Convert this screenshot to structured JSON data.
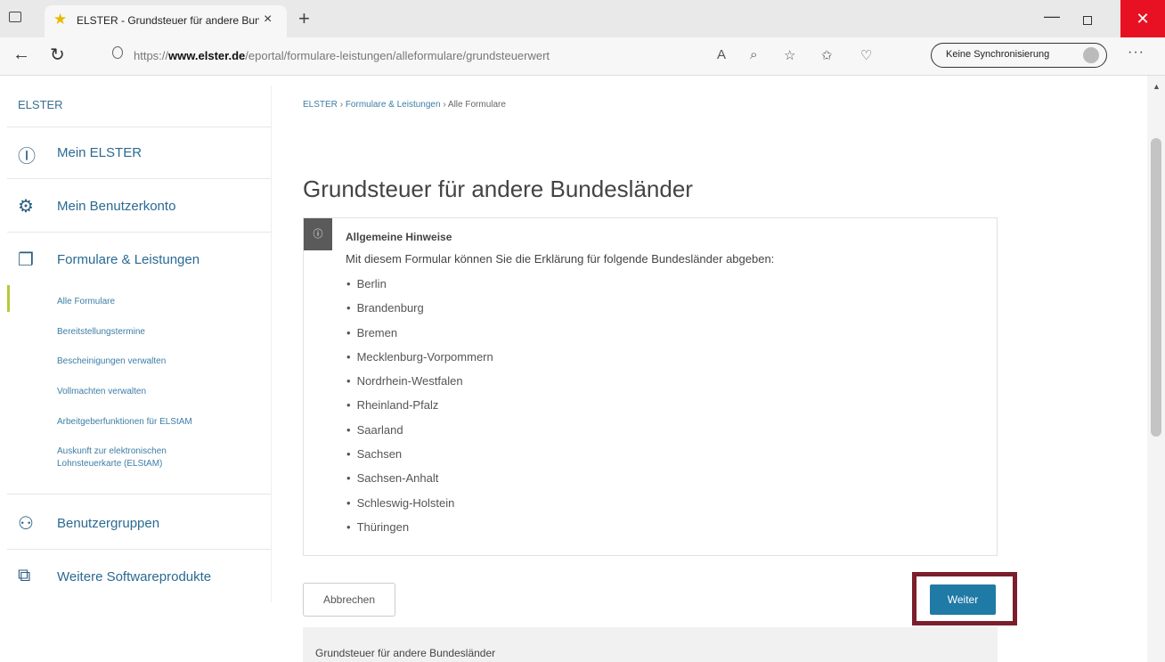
{
  "browser": {
    "tab_title": "ELSTER - Grundsteuer für andere Bundesländer",
    "tab_icon": "star-icon",
    "url_prefix": "https://",
    "url_domain": "www.elster.de",
    "url_path": "/eportal/formulare-leistungen/alleformulare/grundsteuerwert",
    "sync_label": "Keine Synchronisierung",
    "win_close": "✕"
  },
  "sidebar": {
    "brand": "ELSTER",
    "main_items": [
      {
        "label": "Mein ELSTER",
        "icon": "user-circle-icon"
      },
      {
        "label": "Mein Benutzerkonto",
        "icon": "gear-icon"
      },
      {
        "label": "Formulare & Leistungen",
        "icon": "documents-icon"
      },
      {
        "label": "Benutzergruppen",
        "icon": "user-group-icon"
      },
      {
        "label": "Weitere Softwareprodukte",
        "icon": "software-products-icon"
      }
    ],
    "sub_items": [
      "Alle Formulare",
      "Bereitstellungstermine",
      "Bescheinigungen verwalten",
      "Vollmachten verwalten",
      "Arbeitgeberfunktionen für ELStAM",
      "Auskunft zur elektronischen Lohnsteuerkarte (ELStAM)"
    ]
  },
  "breadcrumb": {
    "items": [
      "ELSTER",
      "Formulare & Leistungen",
      "Alle Formulare"
    ],
    "separator": "›"
  },
  "main": {
    "title": "Grundsteuer für andere Bundesländer",
    "info_heading": "Allgemeine Hinweise",
    "info_text": "Mit diesem Formular können Sie die Erklärung für folgende Bundesländer abgeben:",
    "states": [
      "Berlin",
      "Brandenburg",
      "Bremen",
      "Mecklenburg-Vorpommern",
      "Nordrhein-Westfalen",
      "Rheinland-Pfalz",
      "Saarland",
      "Sachsen",
      "Sachsen-Anhalt",
      "Schleswig-Holstein",
      "Thüringen"
    ],
    "cancel_label": "Abbrechen",
    "next_label": "Weiter",
    "footer_text": "Grundsteuer für andere Bundesländer"
  },
  "colors": {
    "accent": "#1f7aa6",
    "highlight_border": "#7a1f2b",
    "active_marker": "#b6c93a",
    "close_button": "#e81123"
  }
}
